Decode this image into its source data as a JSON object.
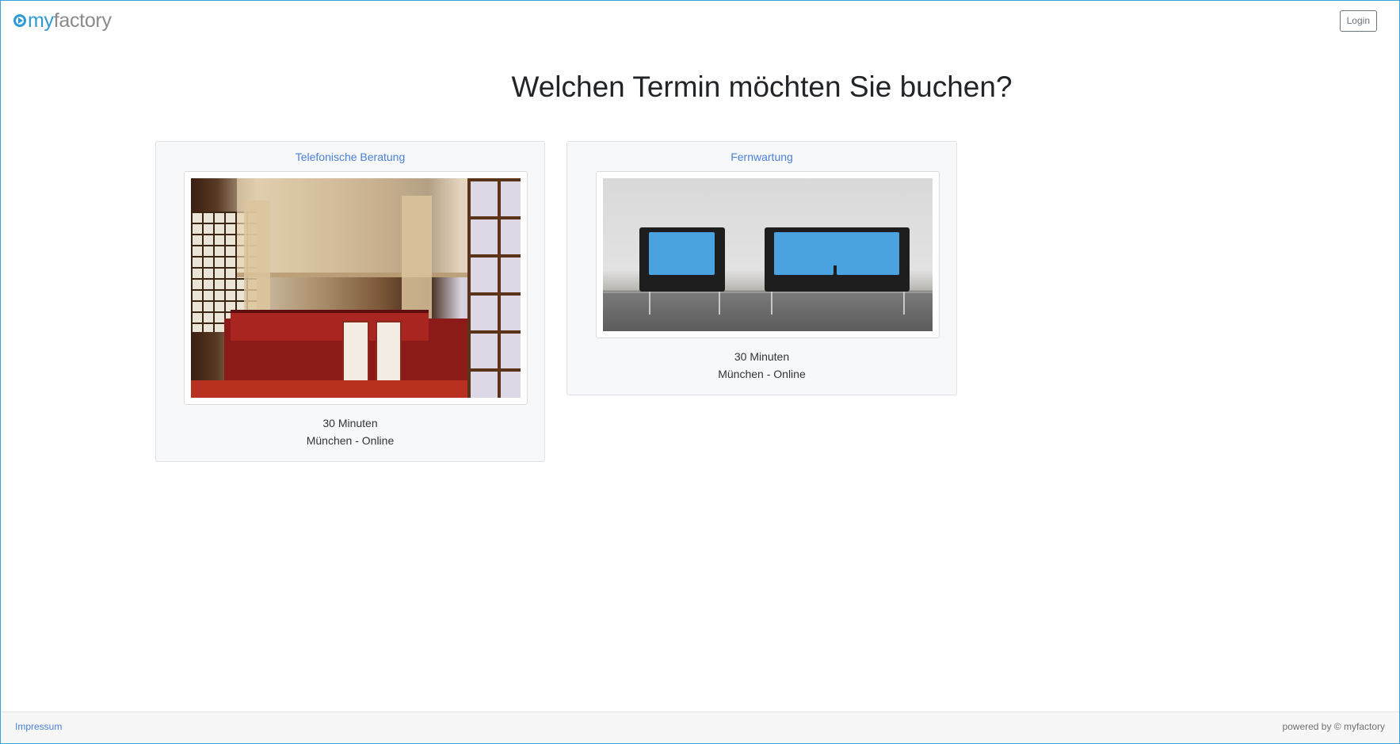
{
  "header": {
    "logo": {
      "my": "my",
      "factory": "factory"
    },
    "login_label": "Login"
  },
  "main": {
    "title": "Welchen Termin möchten Sie buchen?",
    "cards": [
      {
        "title": "Telefonische Beratung",
        "duration": "30 Minuten",
        "location": "München - Online",
        "image_icon": "room-photo"
      },
      {
        "title": "Fernwartung",
        "duration": "30 Minuten",
        "location": "München - Online",
        "image_icon": "chairs-photo"
      }
    ]
  },
  "footer": {
    "impressum": "Impressum",
    "powered": "powered by © myfactory"
  },
  "colors": {
    "accent": "#2d9ad6",
    "link": "#4a7fd6"
  }
}
